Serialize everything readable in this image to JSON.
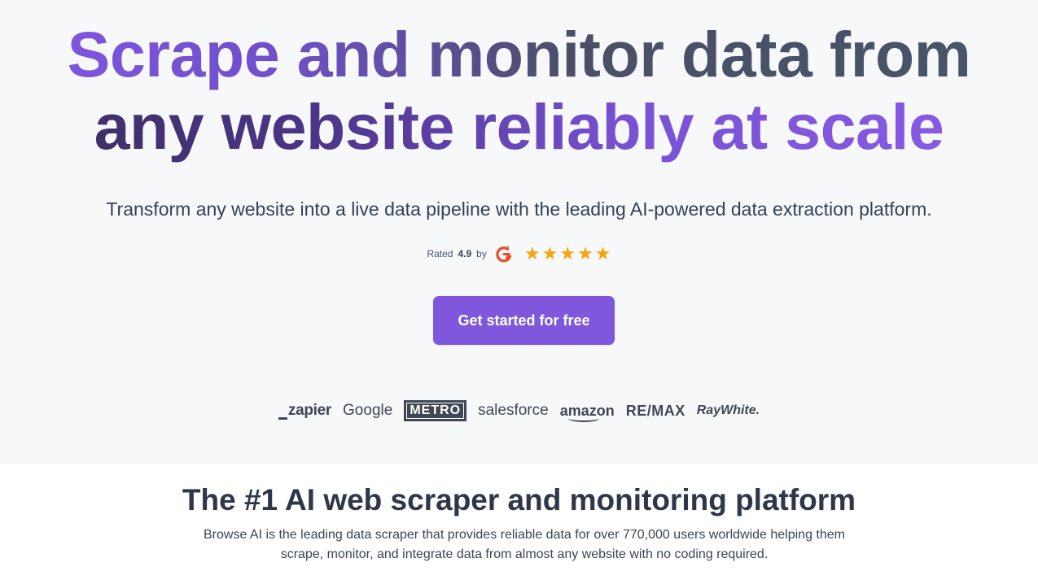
{
  "hero": {
    "headline": {
      "line1": "Scrape and monitor data from",
      "line2": "any website reliably at scale"
    },
    "subtitle": "Transform any website into a live data pipeline with the leading AI-powered data extraction platform.",
    "rating": {
      "prefix": "Rated",
      "score": "4.9",
      "by": "by",
      "platform_icon": "g2-logo-icon",
      "stars": 5,
      "star_color": "#f6a609"
    },
    "cta_label": "Get started for free",
    "logos": [
      "zapier",
      "Google",
      "METRO",
      "salesforce",
      "amazon",
      "RE/MAX",
      "RayWhite."
    ]
  },
  "section": {
    "title": "The #1 AI web scraper and monitoring platform",
    "description_line1": "Browse AI is the leading data scraper that provides reliable data for over 770,000 users worldwide helping them",
    "description_line2": "scrape, monitor, and integrate data from almost any website with no coding required."
  },
  "colors": {
    "accent": "#7e57dc",
    "hero_bg": "#f7f8fa",
    "text_dark": "#2d3748"
  }
}
